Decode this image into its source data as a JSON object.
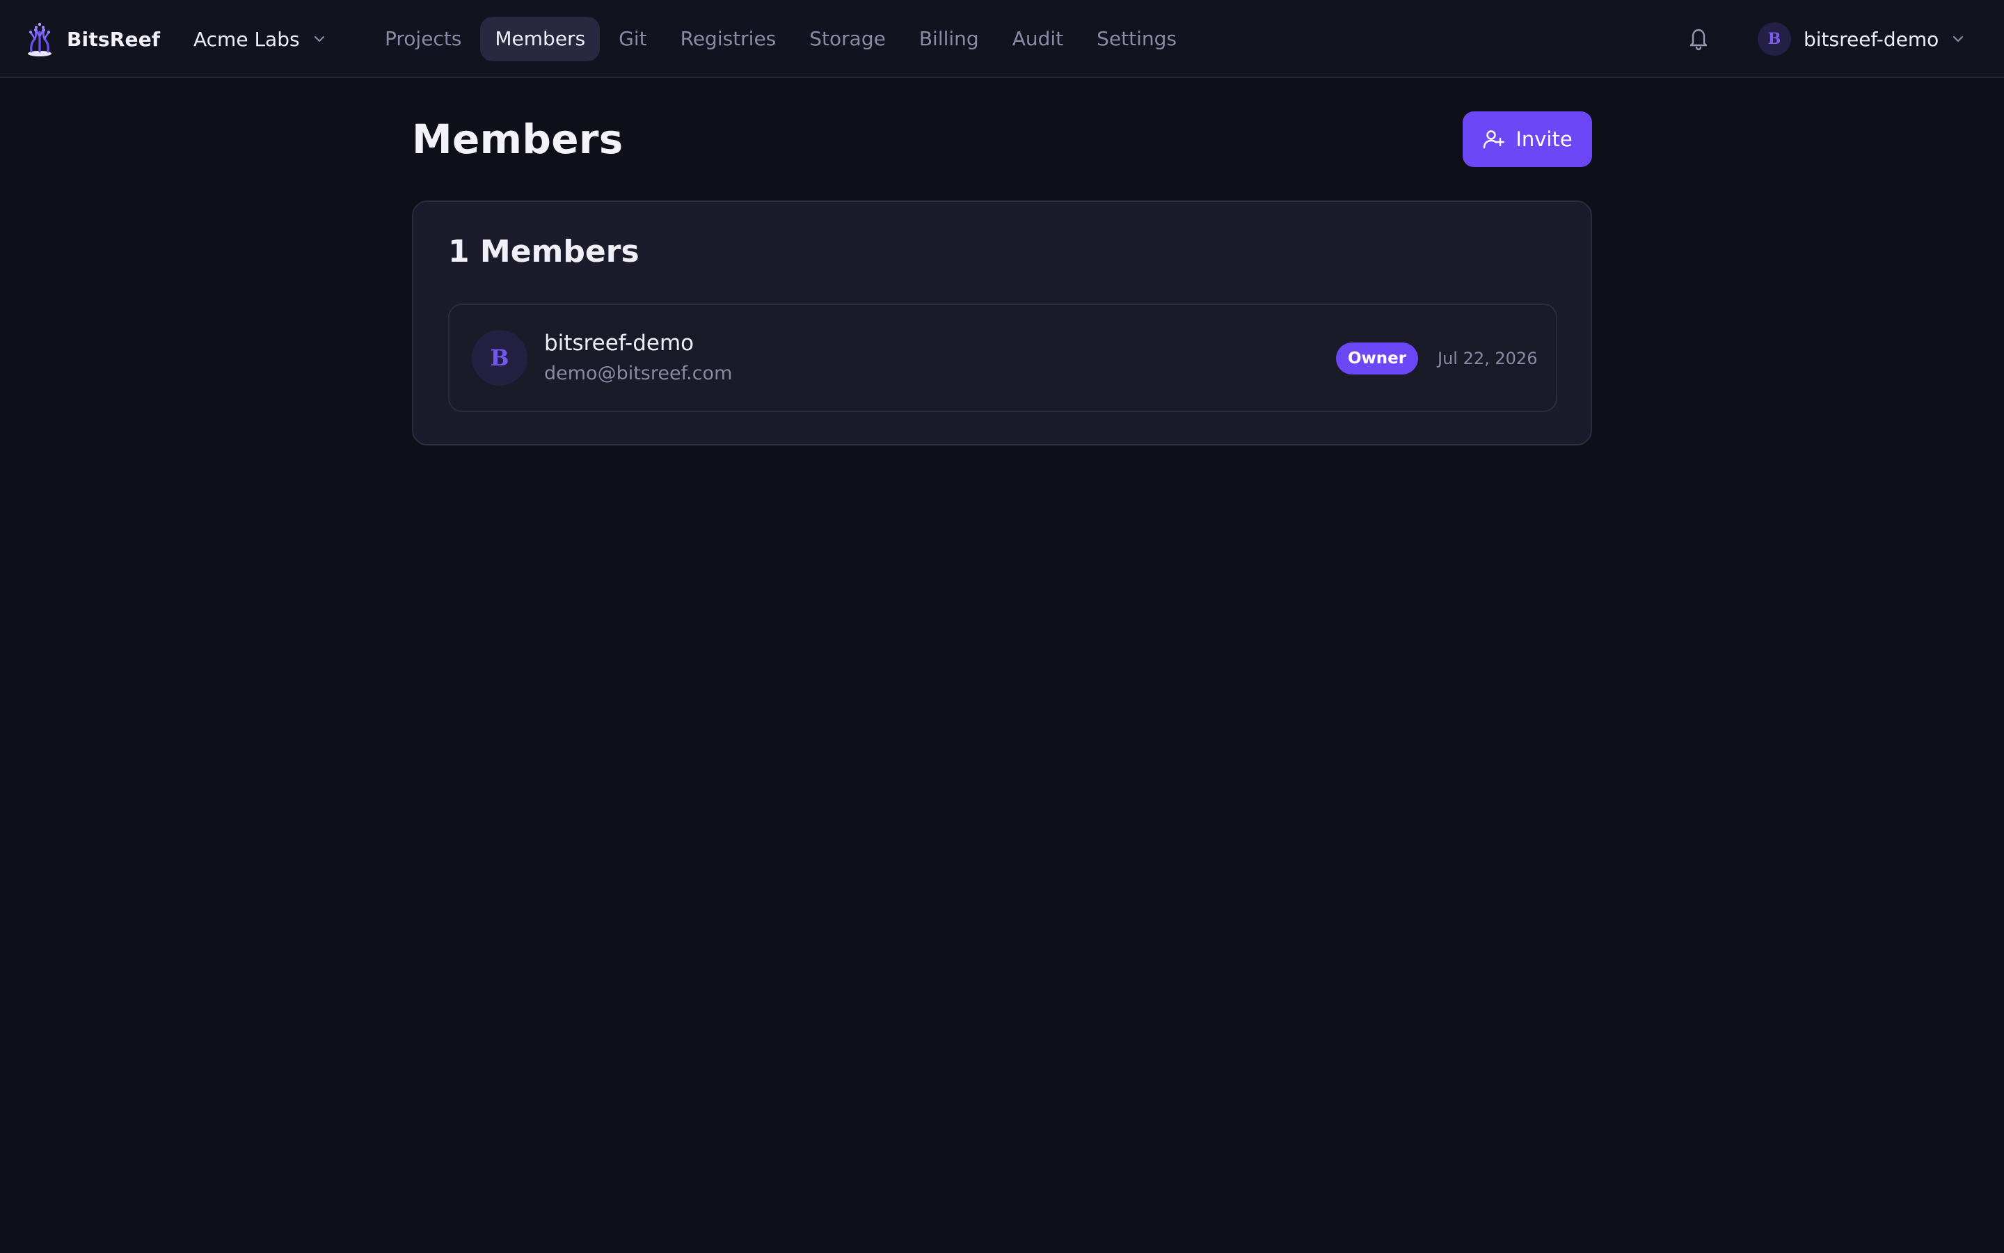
{
  "brand": {
    "name": "BitsReef",
    "logo_icon": "coral-reef-logo-icon"
  },
  "org": {
    "name": "Acme Labs",
    "icon": "chevron-down-icon"
  },
  "nav": {
    "items": [
      {
        "label": "Projects"
      },
      {
        "label": "Members",
        "active": true
      },
      {
        "label": "Git"
      },
      {
        "label": "Registries"
      },
      {
        "label": "Storage"
      },
      {
        "label": "Billing"
      },
      {
        "label": "Audit"
      },
      {
        "label": "Settings"
      }
    ]
  },
  "header": {
    "notifications_icon": "bell-icon"
  },
  "user": {
    "initial": "B",
    "name": "bitsreef-demo",
    "icon": "chevron-down-icon"
  },
  "page": {
    "title": "Members",
    "invite_label": "Invite",
    "invite_icon": "user-plus-icon"
  },
  "members_card": {
    "title": "1 Members",
    "members": [
      {
        "initial": "B",
        "name": "bitsreef-demo",
        "email": "demo@bitsreef.com",
        "role": "Owner",
        "date": "Jul 22, 2026"
      }
    ]
  },
  "colors": {
    "background": "#0f0f19",
    "topbar": "#13131f",
    "card": "#1b1b2b",
    "accent": "#6c47f5",
    "muted_text": "#8a89a4"
  }
}
